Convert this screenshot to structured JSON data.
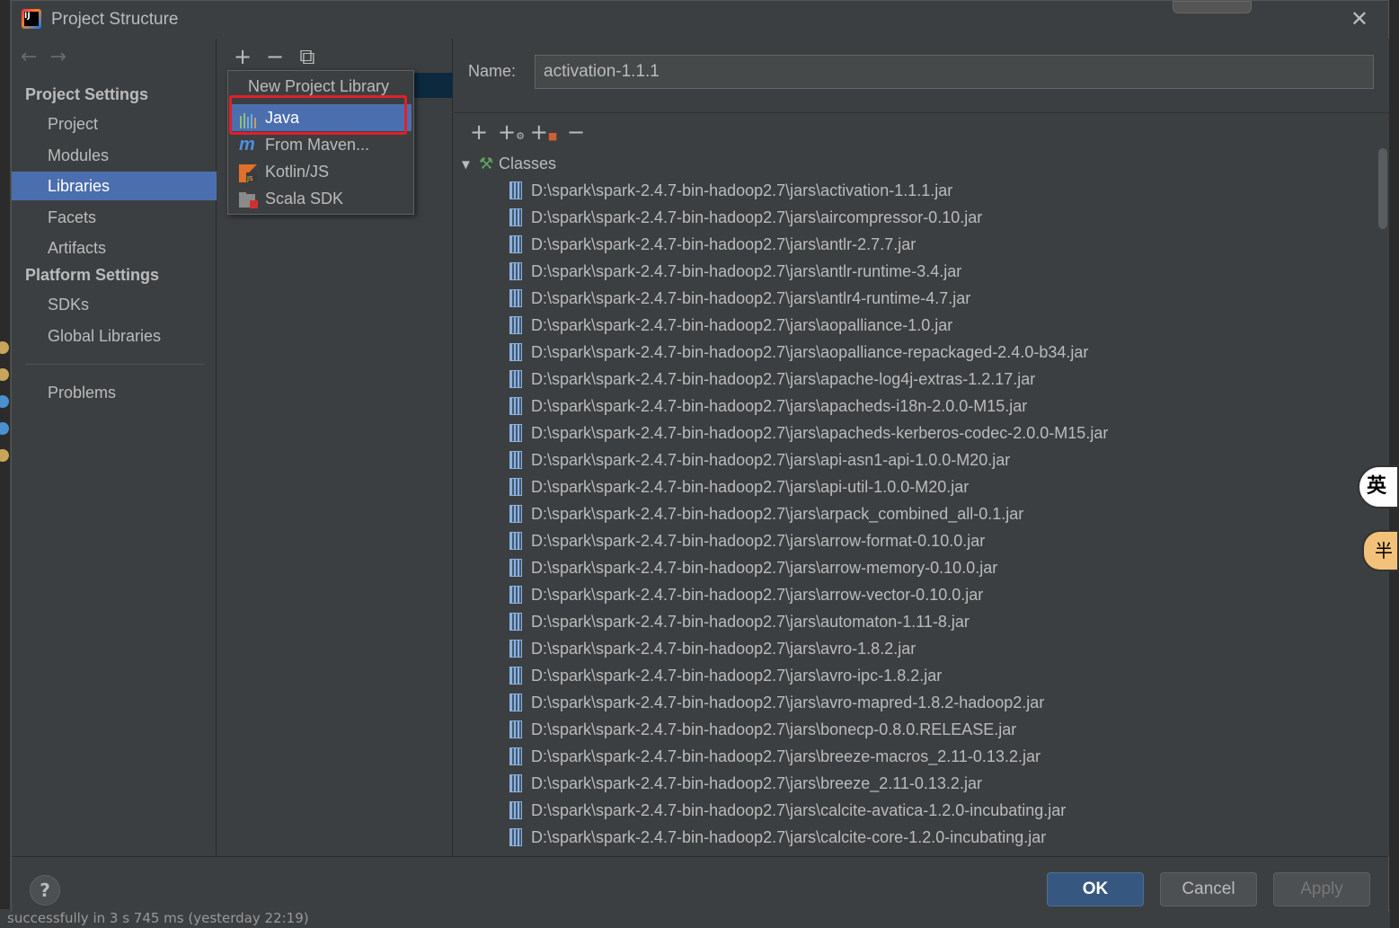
{
  "window": {
    "title": "Project Structure"
  },
  "background": {
    "status_text": "successfully in 3 s 745 ms (yesterday 22:19)"
  },
  "nav": {
    "project_settings_title": "Project Settings",
    "platform_settings_title": "Platform Settings",
    "items": [
      {
        "label": "Project"
      },
      {
        "label": "Modules"
      },
      {
        "label": "Libraries",
        "selected": true
      },
      {
        "label": "Facets"
      },
      {
        "label": "Artifacts"
      },
      {
        "label": "SDKs"
      },
      {
        "label": "Global Libraries"
      },
      {
        "label": "Problems"
      }
    ]
  },
  "popup": {
    "title": "New Project Library",
    "items": [
      {
        "label": "Java",
        "icon": "java-library-icon",
        "selected": true
      },
      {
        "label": "From Maven...",
        "icon": "maven-icon"
      },
      {
        "label": "Kotlin/JS",
        "icon": "kotlin-js-icon"
      },
      {
        "label": "Scala SDK",
        "icon": "scala-sdk-icon"
      }
    ]
  },
  "details": {
    "name_label": "Name:",
    "name_value": "activation-1.1.1",
    "root_label": "Classes",
    "jars": [
      "D:\\spark\\spark-2.4.7-bin-hadoop2.7\\jars\\activation-1.1.1.jar",
      "D:\\spark\\spark-2.4.7-bin-hadoop2.7\\jars\\aircompressor-0.10.jar",
      "D:\\spark\\spark-2.4.7-bin-hadoop2.7\\jars\\antlr-2.7.7.jar",
      "D:\\spark\\spark-2.4.7-bin-hadoop2.7\\jars\\antlr-runtime-3.4.jar",
      "D:\\spark\\spark-2.4.7-bin-hadoop2.7\\jars\\antlr4-runtime-4.7.jar",
      "D:\\spark\\spark-2.4.7-bin-hadoop2.7\\jars\\aopalliance-1.0.jar",
      "D:\\spark\\spark-2.4.7-bin-hadoop2.7\\jars\\aopalliance-repackaged-2.4.0-b34.jar",
      "D:\\spark\\spark-2.4.7-bin-hadoop2.7\\jars\\apache-log4j-extras-1.2.17.jar",
      "D:\\spark\\spark-2.4.7-bin-hadoop2.7\\jars\\apacheds-i18n-2.0.0-M15.jar",
      "D:\\spark\\spark-2.4.7-bin-hadoop2.7\\jars\\apacheds-kerberos-codec-2.0.0-M15.jar",
      "D:\\spark\\spark-2.4.7-bin-hadoop2.7\\jars\\api-asn1-api-1.0.0-M20.jar",
      "D:\\spark\\spark-2.4.7-bin-hadoop2.7\\jars\\api-util-1.0.0-M20.jar",
      "D:\\spark\\spark-2.4.7-bin-hadoop2.7\\jars\\arpack_combined_all-0.1.jar",
      "D:\\spark\\spark-2.4.7-bin-hadoop2.7\\jars\\arrow-format-0.10.0.jar",
      "D:\\spark\\spark-2.4.7-bin-hadoop2.7\\jars\\arrow-memory-0.10.0.jar",
      "D:\\spark\\spark-2.4.7-bin-hadoop2.7\\jars\\arrow-vector-0.10.0.jar",
      "D:\\spark\\spark-2.4.7-bin-hadoop2.7\\jars\\automaton-1.11-8.jar",
      "D:\\spark\\spark-2.4.7-bin-hadoop2.7\\jars\\avro-1.8.2.jar",
      "D:\\spark\\spark-2.4.7-bin-hadoop2.7\\jars\\avro-ipc-1.8.2.jar",
      "D:\\spark\\spark-2.4.7-bin-hadoop2.7\\jars\\avro-mapred-1.8.2-hadoop2.jar",
      "D:\\spark\\spark-2.4.7-bin-hadoop2.7\\jars\\bonecp-0.8.0.RELEASE.jar",
      "D:\\spark\\spark-2.4.7-bin-hadoop2.7\\jars\\breeze-macros_2.11-0.13.2.jar",
      "D:\\spark\\spark-2.4.7-bin-hadoop2.7\\jars\\breeze_2.11-0.13.2.jar",
      "D:\\spark\\spark-2.4.7-bin-hadoop2.7\\jars\\calcite-avatica-1.2.0-incubating.jar",
      "D:\\spark\\spark-2.4.7-bin-hadoop2.7\\jars\\calcite-core-1.2.0-incubating.jar"
    ]
  },
  "buttons": {
    "help": "?",
    "ok": "OK",
    "cancel": "Cancel",
    "apply": "Apply"
  },
  "floating": {
    "ime_label": "英"
  },
  "colors": {
    "selection": "#4b6eaf",
    "highlight_box": "#e0202a",
    "dialog_bg": "#3c3f41",
    "primary_button": "#365880"
  }
}
